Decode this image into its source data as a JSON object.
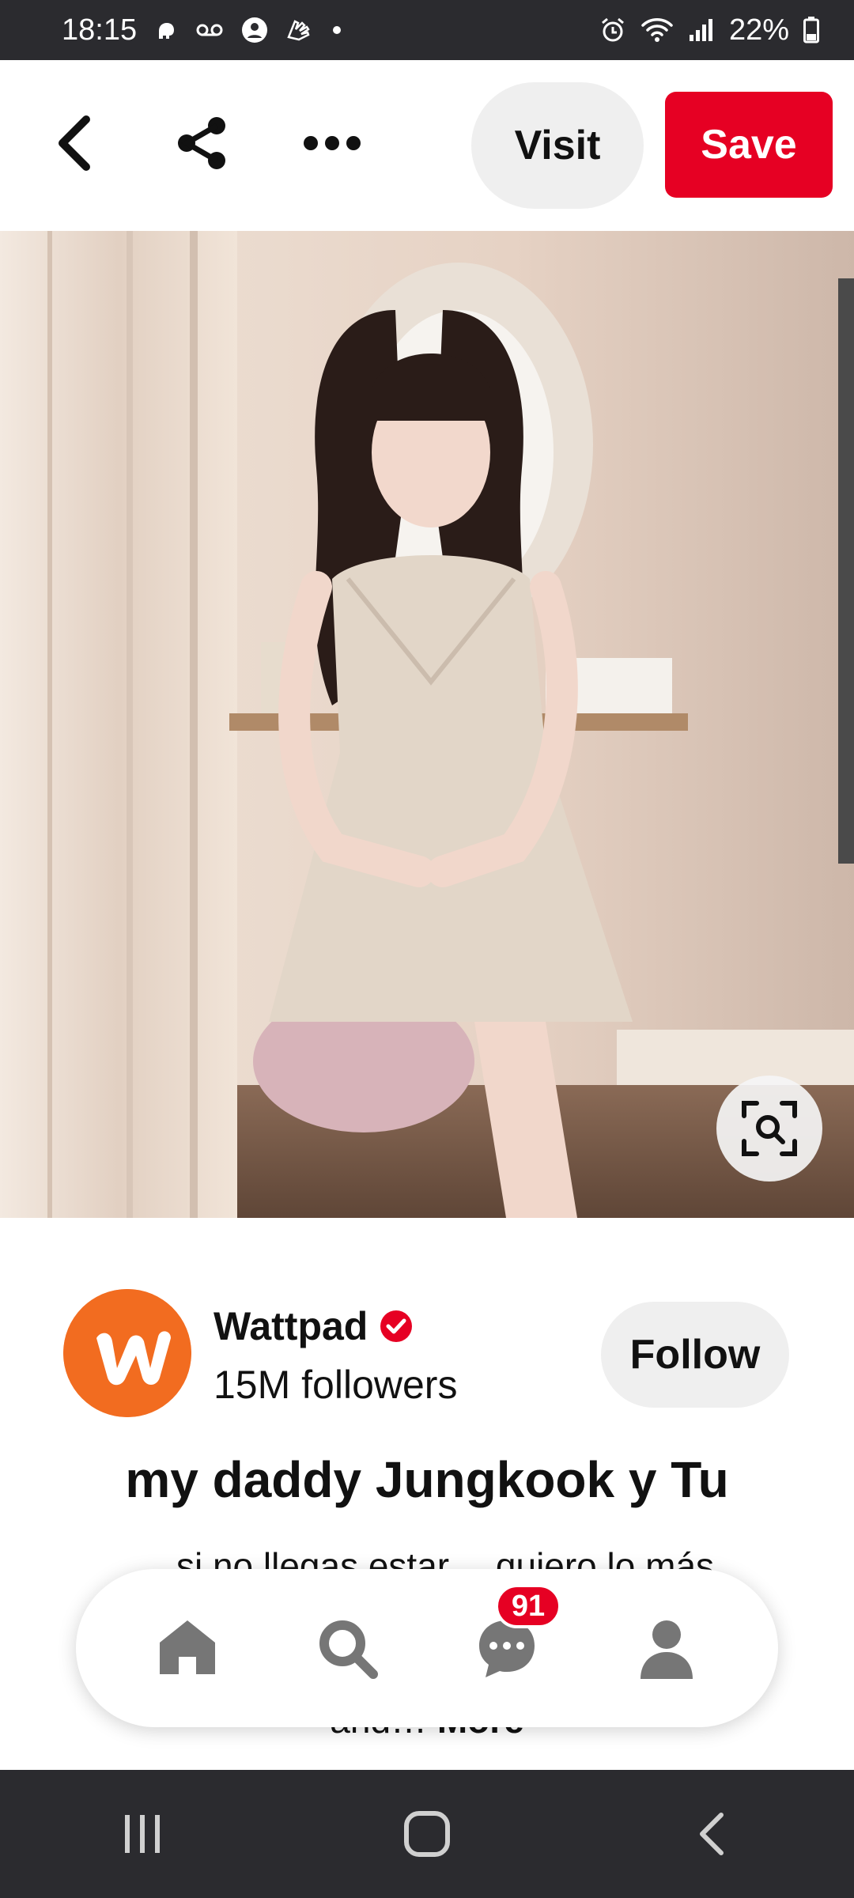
{
  "status_bar": {
    "time": "18:15",
    "battery": "22%",
    "icons_left": [
      "elephant-icon",
      "voicemail-icon",
      "account-icon",
      "glove-icon",
      "dot-icon"
    ],
    "icons_right": [
      "alarm-icon",
      "wifi-icon",
      "signal-icon",
      "battery-icon"
    ]
  },
  "topbar": {
    "visit_label": "Visit",
    "save_label": "Save",
    "icons": [
      "back-arrow-icon",
      "share-icon",
      "more-icon"
    ],
    "save_color": "#e60023"
  },
  "creator": {
    "name": "Wattpad",
    "followers": "15M followers",
    "follow_label": "Follow",
    "avatar_color": "#f26c20"
  },
  "pin": {
    "title": "my daddy Jungkook y Tu",
    "description": "…si no llegas estar… quiero lo más",
    "description_tail": "and… ",
    "more_label": "More"
  },
  "bottom_nav": {
    "items": [
      "home-icon",
      "search-icon",
      "messages-icon",
      "profile-icon"
    ],
    "messages_badge": "91"
  },
  "system_nav": [
    "recents-icon",
    "home-button-icon",
    "back-icon"
  ]
}
